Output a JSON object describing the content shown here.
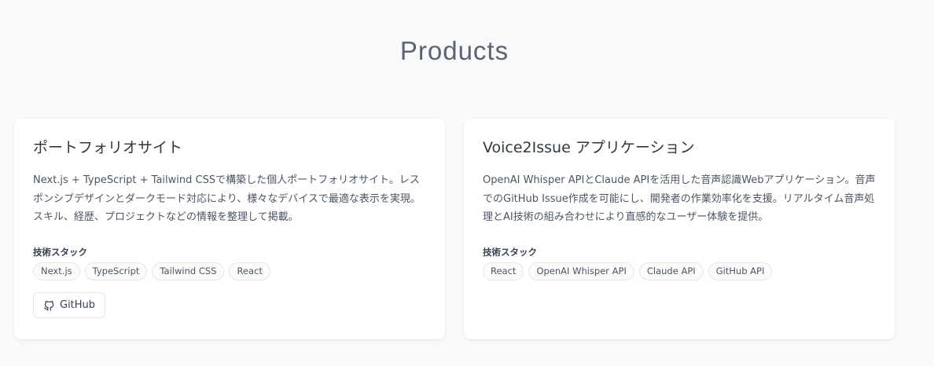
{
  "section": {
    "title": "Products"
  },
  "products": [
    {
      "title": "ポートフォリオサイト",
      "description": "Next.js + TypeScript + Tailwind CSSで構築した個人ポートフォリオサイト。レスポンシブデザインとダークモード対応により、様々なデバイスで最適な表示を実現。スキル、経歴、プロジェクトなどの情報を整理して掲載。",
      "stack_label": "技術スタック",
      "tags": [
        "Next.js",
        "TypeScript",
        "Tailwind CSS",
        "React"
      ],
      "github_label": "GitHub",
      "github_icon": "github-icon"
    },
    {
      "title": "Voice2Issue アプリケーション",
      "description": "OpenAI Whisper APIとClaude APIを活用した音声認識Webアプリケーション。音声でのGitHub Issue作成を可能にし、開発者の作業効率化を支援。リアルタイム音声処理とAI技術の組み合わせにより直感的なユーザー体験を提供。",
      "stack_label": "技術スタック",
      "tags": [
        "React",
        "OpenAI Whisper API",
        "Claude API",
        "GitHub API"
      ]
    }
  ],
  "colors": {
    "background": "#f8f9fb",
    "card": "#ffffff",
    "title": "#5b6470",
    "tag_border": "#e3e6ea"
  }
}
